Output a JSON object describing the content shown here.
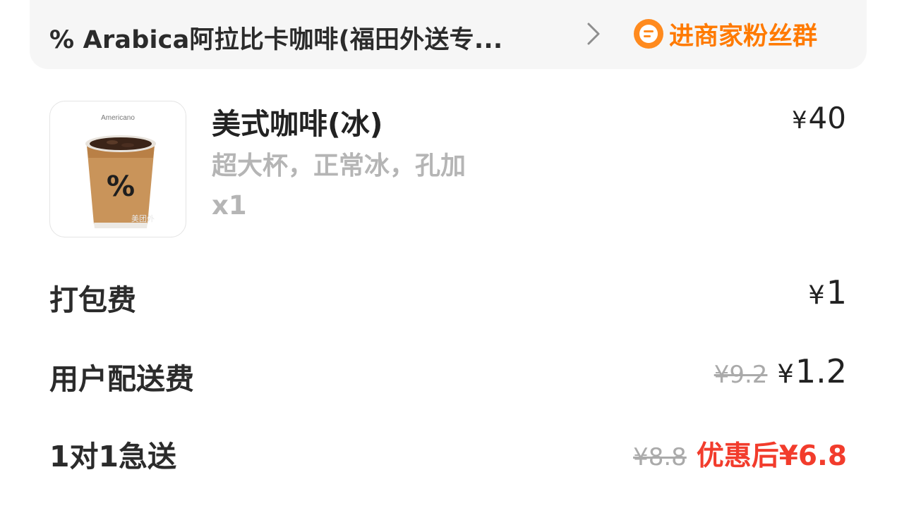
{
  "store": {
    "name": "% Arabica阿拉比卡咖啡(福田外送专...",
    "fan_group_label": "进商家粉丝群",
    "accent_color": "#ff7a00"
  },
  "product": {
    "image_caption": "Americano",
    "image_watermark": "美团外",
    "title": "美式咖啡(冰)",
    "spec": "超大杯，正常冰，孔加",
    "qty": "x1",
    "price_yen": "¥",
    "price": "40"
  },
  "fees": {
    "packaging": {
      "label": "打包费",
      "yen": "¥",
      "price": "1"
    },
    "delivery": {
      "label": "用户配送费",
      "original": "¥9.2",
      "yen": "¥",
      "price": "1.2"
    },
    "express": {
      "label": "1对1急送",
      "original": "¥8.8",
      "discount": "优惠后¥6.8",
      "discount_color": "#f23c2c"
    }
  }
}
